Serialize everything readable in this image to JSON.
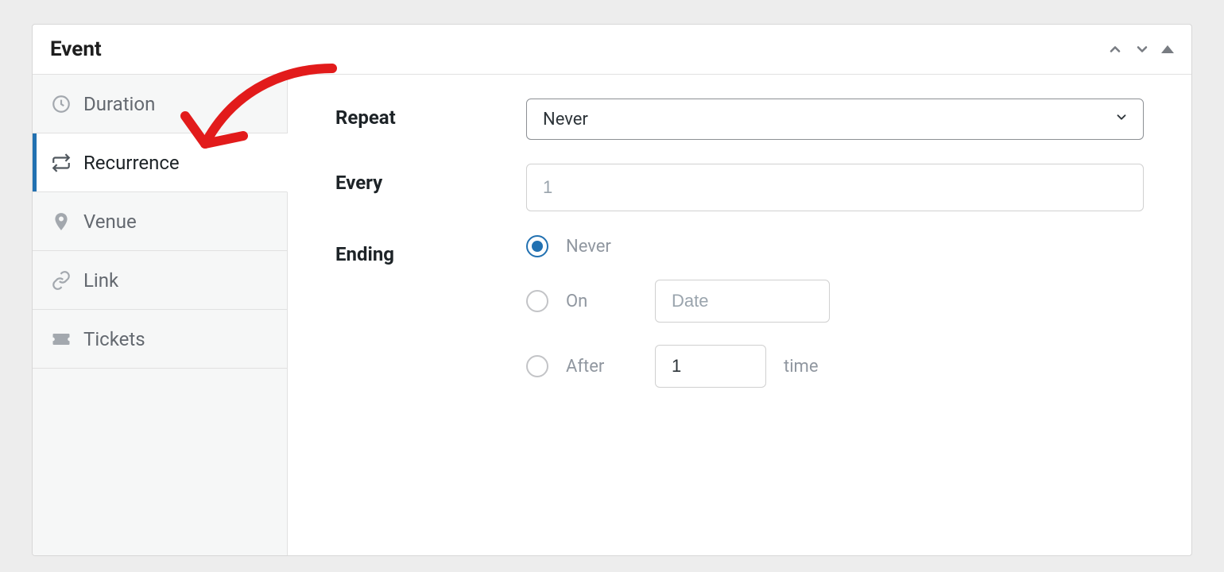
{
  "panel_title": "Event",
  "sidebar": {
    "items": [
      {
        "label": "Duration",
        "icon": "clock-icon",
        "active": false
      },
      {
        "label": "Recurrence",
        "icon": "repeat-icon",
        "active": true
      },
      {
        "label": "Venue",
        "icon": "location-icon",
        "active": false
      },
      {
        "label": "Link",
        "icon": "link-icon",
        "active": false
      },
      {
        "label": "Tickets",
        "icon": "ticket-icon",
        "active": false
      }
    ]
  },
  "form": {
    "repeat": {
      "label": "Repeat",
      "value": "Never"
    },
    "every": {
      "label": "Every",
      "placeholder": "1"
    },
    "ending": {
      "label": "Ending",
      "options": {
        "never": {
          "label": "Never",
          "selected": true
        },
        "on": {
          "label": "On",
          "date_placeholder": "Date",
          "selected": false
        },
        "after": {
          "label": "After",
          "count_value": "1",
          "suffix": "time",
          "selected": false
        }
      }
    }
  }
}
